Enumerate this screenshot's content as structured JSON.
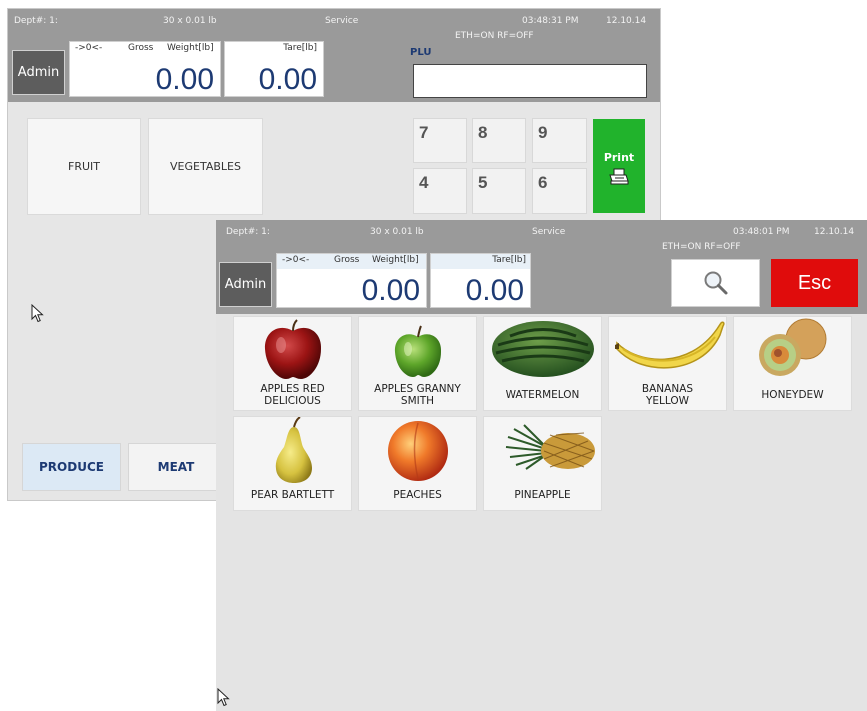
{
  "colors": {
    "header_bg": "#9a9a9a",
    "value_text": "#1d3a73",
    "print_green": "#21b32c",
    "esc_red": "#e00c0c",
    "selected_tab": "#dce9f5"
  },
  "back_window": {
    "header": {
      "dept": "Dept#: 1:",
      "capacity": "30 x 0.01 lb",
      "mode": "Service",
      "time": "03:48:31 PM",
      "date": "12.10.14",
      "status": "ETH=ON  RF=OFF"
    },
    "admin_label": "Admin",
    "weight": {
      "zero_indicator": "->0<-",
      "gross_label": "Gross",
      "weight_label": "Weight[lb]",
      "value": "0.00"
    },
    "tare": {
      "label": "Tare[lb]",
      "value": "0.00"
    },
    "plu_label": "PLU",
    "plu_value": "",
    "categories": [
      "FRUIT",
      "VEGETABLES"
    ],
    "keypad": [
      "7",
      "8",
      "9",
      "4",
      "5",
      "6"
    ],
    "print_label": "Print",
    "print_icon": "printer-icon",
    "tabs": [
      "PRODUCE",
      "MEAT"
    ]
  },
  "front_window": {
    "header": {
      "dept": "Dept#: 1:",
      "capacity": "30 x 0.01 lb",
      "mode": "Service",
      "time": "03:48:01 PM",
      "date": "12.10.14",
      "status": "ETH=ON  RF=OFF"
    },
    "admin_label": "Admin",
    "weight": {
      "zero_indicator": "->0<-",
      "gross_label": "Gross",
      "weight_label": "Weight[lb]",
      "value": "0.00"
    },
    "tare": {
      "label": "Tare[lb]",
      "value": "0.00"
    },
    "search_icon": "magnifier-icon",
    "esc_label": "Esc",
    "products": [
      {
        "line1": "APPLES RED",
        "line2": "DELICIOUS",
        "image": "red-apple"
      },
      {
        "line1": "APPLES GRANNY",
        "line2": "SMITH",
        "image": "green-apple"
      },
      {
        "line1": "WATERMELON",
        "line2": "",
        "image": "watermelon"
      },
      {
        "line1": "BANANAS",
        "line2": "YELLOW",
        "image": "banana"
      },
      {
        "line1": "HONEYDEW",
        "line2": "",
        "image": "honeydew"
      },
      {
        "line1": "PEAR BARTLETT",
        "line2": "",
        "image": "pear"
      },
      {
        "line1": "PEACHES",
        "line2": "",
        "image": "peach"
      },
      {
        "line1": "PINEAPPLE",
        "line2": "",
        "image": "pineapple"
      }
    ]
  }
}
